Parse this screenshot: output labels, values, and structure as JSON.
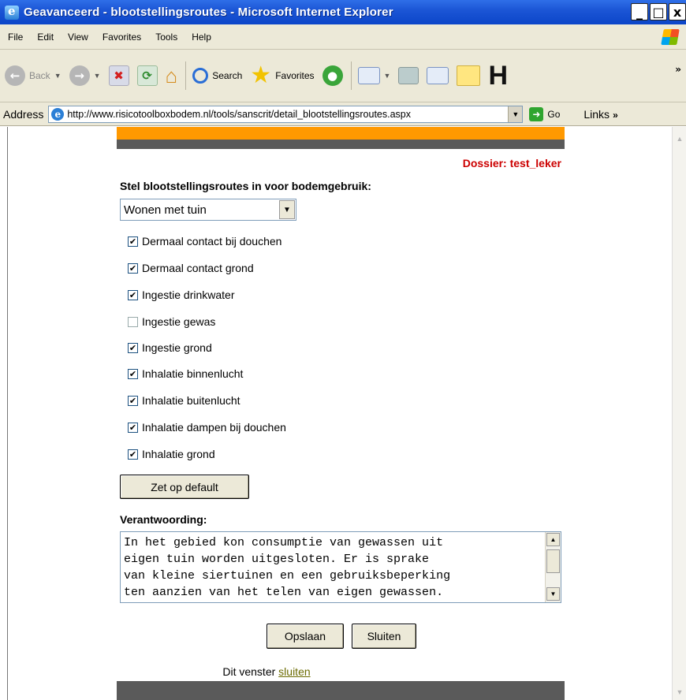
{
  "window": {
    "title": "Geavanceerd - blootstellingsroutes - Microsoft Internet Explorer",
    "buttons": [
      "_",
      "□",
      "x"
    ]
  },
  "menu": [
    "File",
    "Edit",
    "View",
    "Favorites",
    "Tools",
    "Help"
  ],
  "toolbar": {
    "back_label": "Back",
    "search_label": "Search",
    "favorites_label": "Favorites"
  },
  "address": {
    "label": "Address",
    "url": "http://www.risicotoolboxbodem.nl/tools/sanscrit/detail_blootstellingsroutes.aspx",
    "go_label": "Go",
    "links_label": "Links"
  },
  "page": {
    "dossier": "Dossier: test_leker",
    "heading": "Stel blootstellingsroutes in voor bodemgebruik:",
    "land_use_selected": "Wonen met tuin",
    "routes": [
      {
        "label": "Dermaal contact bij douchen",
        "checked": true
      },
      {
        "label": "Dermaal contact grond",
        "checked": true
      },
      {
        "label": "Ingestie drinkwater",
        "checked": true
      },
      {
        "label": "Ingestie gewas",
        "checked": false
      },
      {
        "label": "Ingestie grond",
        "checked": true
      },
      {
        "label": "Inhalatie binnenlucht",
        "checked": true
      },
      {
        "label": "Inhalatie buitenlucht",
        "checked": true
      },
      {
        "label": "Inhalatie dampen bij douchen",
        "checked": true
      },
      {
        "label": "Inhalatie grond",
        "checked": true
      }
    ],
    "default_button": "Zet op default",
    "justification_label": "Verantwoording:",
    "justification_text": "In het gebied kon consumptie van gewassen uit\neigen tuin worden uitgesloten. Er is sprake\nvan kleine siertuinen en een gebruiksbeperking\nten aanzien van het telen van eigen gewassen.",
    "save_button": "Opslaan",
    "close_button": "Sluiten",
    "footer_prefix": "Dit venster",
    "footer_link": "sluiten"
  }
}
